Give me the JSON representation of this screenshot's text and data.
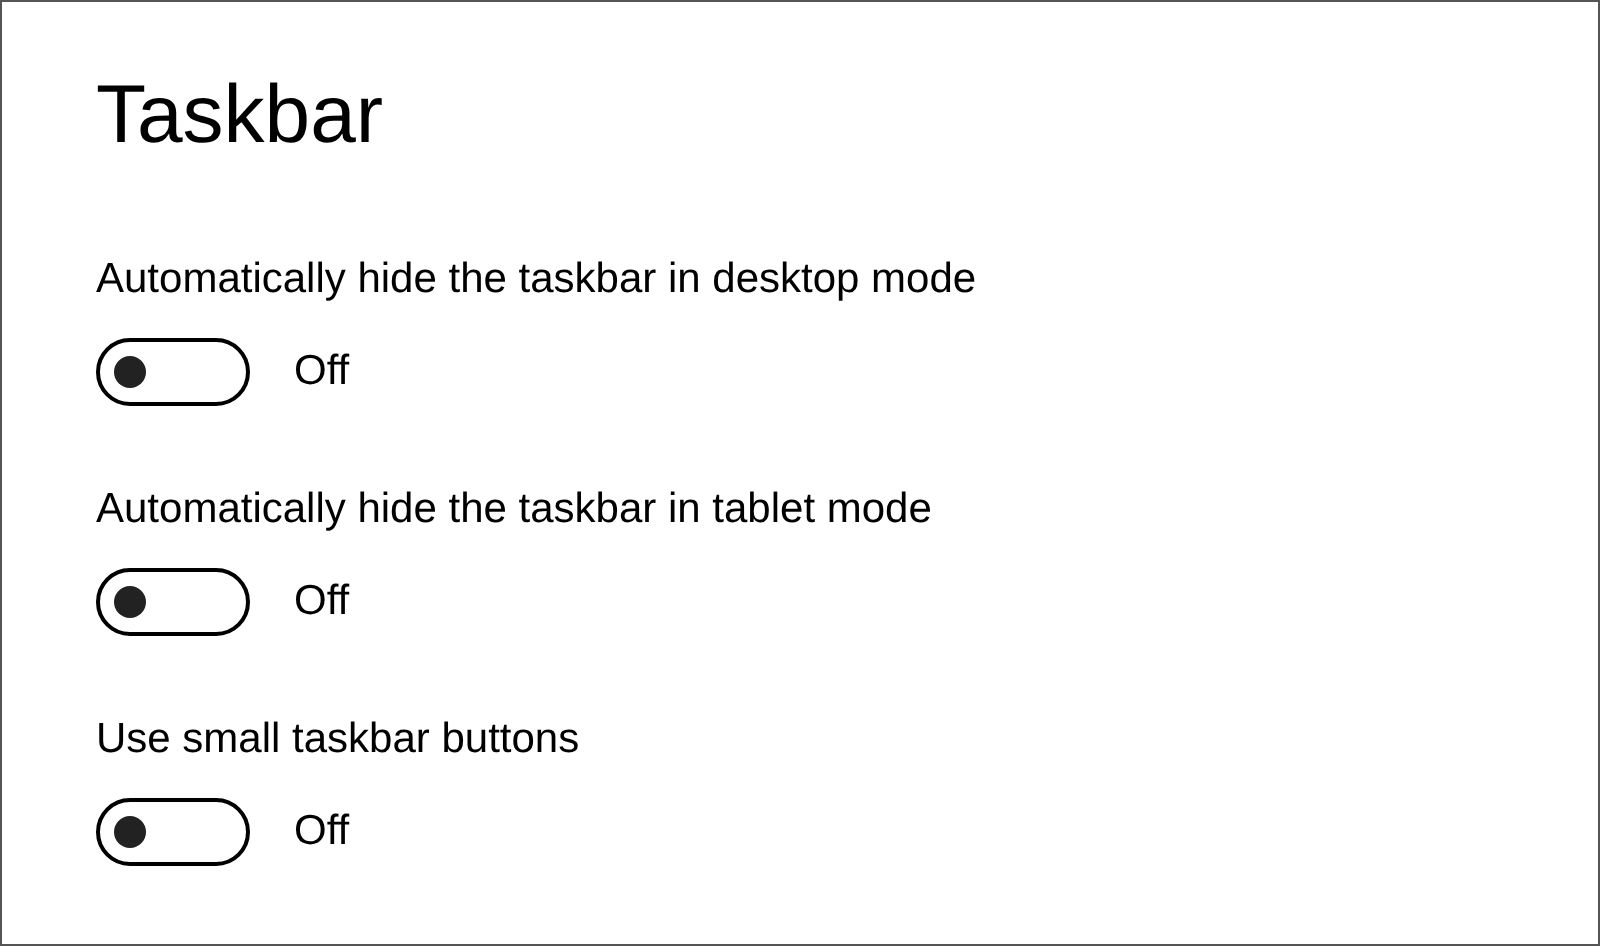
{
  "title": "Taskbar",
  "settings": [
    {
      "label": "Automatically hide the taskbar in desktop mode",
      "on": false,
      "state_text": "Off"
    },
    {
      "label": "Automatically hide the taskbar in tablet mode",
      "on": false,
      "state_text": "Off"
    },
    {
      "label": "Use small taskbar buttons",
      "on": false,
      "state_text": "Off"
    }
  ]
}
